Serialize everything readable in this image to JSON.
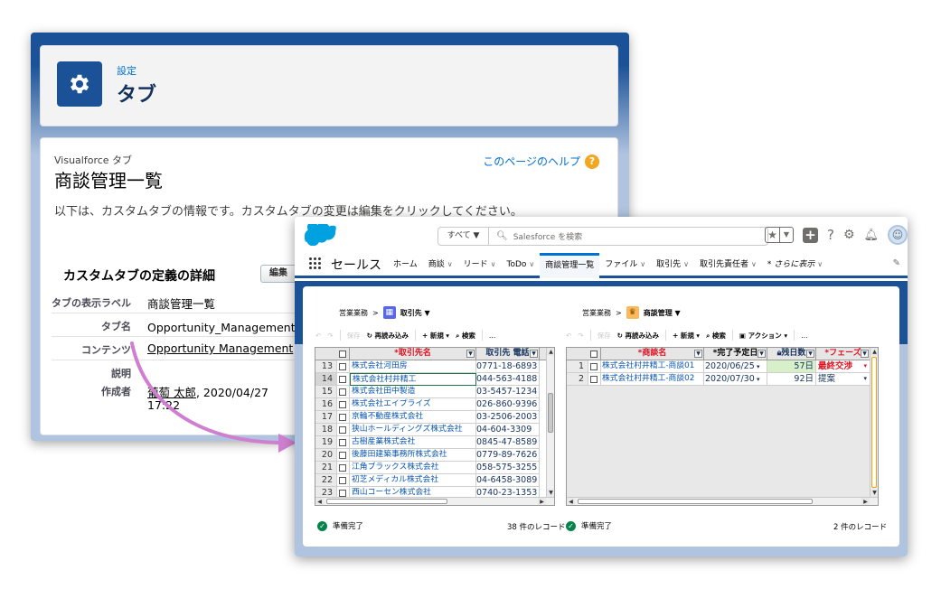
{
  "setup": {
    "breadcrumb": "設定",
    "title": "タブ",
    "vf_label": "Visualforce タブ",
    "vf_title": "商談管理一覧",
    "help_link": "このページのヘルプ",
    "intro": "以下は、カスタムタブの情報です。カスタムタブの変更は編集をクリックしてください。",
    "section_title": "カスタムタブの定義の詳細",
    "edit_button": "編集",
    "rows": [
      {
        "label": "タブの表示ラベル",
        "value": "商談管理一覧"
      },
      {
        "label": "タブ名",
        "value": "Opportunity_Management ス"
      },
      {
        "label": "コンテンツ",
        "value": "Opportunity Management"
      },
      {
        "label": "説明",
        "value": ""
      },
      {
        "label": "作成者",
        "value_link": "葡萄 太郎",
        "value_rest": ", 2020/04/27",
        "value_line2": "17:22"
      }
    ]
  },
  "sales": {
    "search_scope": "すべて ▼",
    "search_placeholder": "Salesforce を検索",
    "app_name": "セールス",
    "nav": [
      {
        "label": "ホーム",
        "caret": false,
        "active": false
      },
      {
        "label": "商談",
        "caret": true,
        "active": false
      },
      {
        "label": "リード",
        "caret": true,
        "active": false
      },
      {
        "label": "ToDo",
        "caret": true,
        "active": false
      },
      {
        "label": "商談管理一覧",
        "caret": false,
        "active": true
      },
      {
        "label": "ファイル",
        "caret": true,
        "active": false
      },
      {
        "label": "取引先",
        "caret": true,
        "active": false
      },
      {
        "label": "取引先責任者",
        "caret": true,
        "active": false
      },
      {
        "label": "* さらに表示",
        "caret": true,
        "active": false
      }
    ],
    "left": {
      "breadcrumb_app": "営業業務",
      "breadcrumb_obj": "取引先 ▼",
      "icon_color": "#5867e8",
      "toolbar": {
        "undo": "↶",
        "redo": "↷",
        "save": "保存",
        "reload": "再読み込み",
        "new": "新規",
        "search": "検索",
        "more": "…"
      },
      "headers": [
        "*取引先名",
        "取引先 電話"
      ],
      "rows": [
        {
          "n": "13",
          "name": "株式会社河田房",
          "phone": "0771-18-6893"
        },
        {
          "n": "14",
          "name": "株式会社村井精工",
          "phone": "044-563-4188"
        },
        {
          "n": "15",
          "name": "株式会社田中製造",
          "phone": "03-5457-1234"
        },
        {
          "n": "16",
          "name": "株式会社エイプライズ",
          "phone": "026-860-9396"
        },
        {
          "n": "17",
          "name": "京輪不動産株式会社",
          "phone": "03-2506-2003"
        },
        {
          "n": "18",
          "name": "狭山ホールディングズ株式会社",
          "phone": "04-604-3309"
        },
        {
          "n": "19",
          "name": "古樹産業株式会社",
          "phone": "0845-47-8589"
        },
        {
          "n": "20",
          "name": "後藤田建築事務所株式会社",
          "phone": "0779-89-7626"
        },
        {
          "n": "21",
          "name": "江角ブラックス株式会社",
          "phone": "058-575-3255"
        },
        {
          "n": "22",
          "name": "初芝メディカル株式会社",
          "phone": "04-6458-3089"
        },
        {
          "n": "23",
          "name": "西山コーセン株式会社",
          "phone": "0740-23-1353"
        }
      ],
      "status": "準備完了",
      "count": "38 件のレコード"
    },
    "right": {
      "breadcrumb_app": "営業業務",
      "breadcrumb_obj": "商談管理 ▼",
      "icon_color": "#fcb95b",
      "toolbar": {
        "undo": "↶",
        "redo": "↷",
        "save": "保存",
        "reload": "再読み込み",
        "new": "新規",
        "search": "検索",
        "action": "アクション ▾",
        "more": "…"
      },
      "headers": [
        "*商談名",
        "*完了予定日",
        "残日数",
        "*フェーズ"
      ],
      "rows": [
        {
          "n": "1",
          "name": "株式会社村井精工-商談01",
          "date": "2020/06/25",
          "days": "57日",
          "phase": "最終交渉"
        },
        {
          "n": "2",
          "name": "株式会社村井精工-商談02",
          "date": "2020/07/30",
          "days": "92日",
          "phase": "提案"
        }
      ],
      "status": "準備完了",
      "count": "2 件のレコード"
    }
  }
}
